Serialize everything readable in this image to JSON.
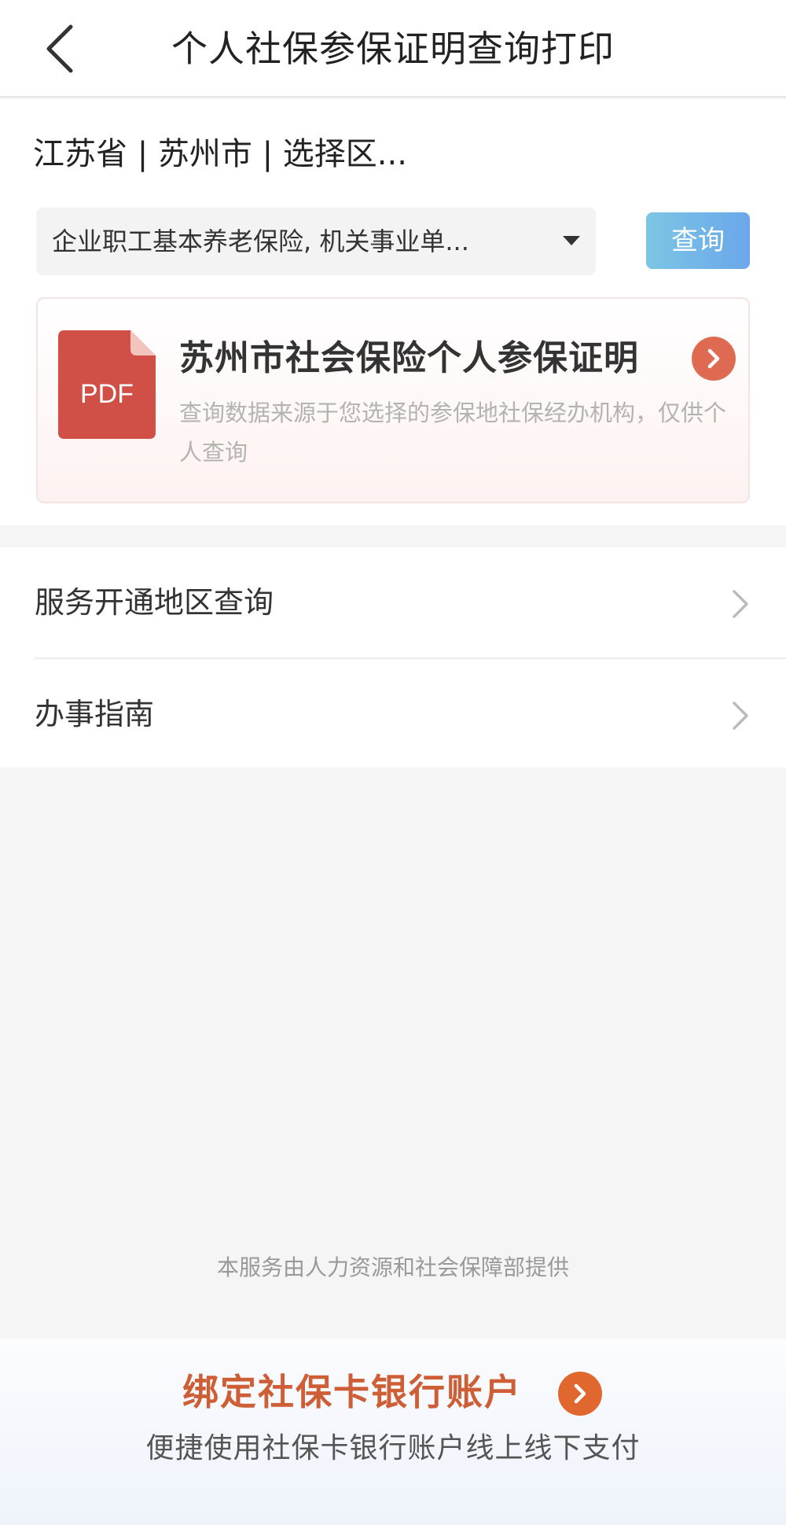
{
  "header": {
    "title": "个人社保参保证明查询打印",
    "back_icon": "chevron-left-icon"
  },
  "region": {
    "text": "江苏省 | 苏州市 | 选择区..."
  },
  "insurance_select": {
    "selected_value": "企业职工基本养老保险, 机关事业单..."
  },
  "query_button": {
    "label": "查询",
    "colors": [
      "#7cc6e4",
      "#6aa7ea"
    ]
  },
  "certificate_card": {
    "icon_label": "PDF",
    "title": "苏州市社会保险个人参保证明",
    "description": "查询数据来源于您选择的参保地社保经办机构，仅供个人查询",
    "accent_color": "#de6a52",
    "pdf_icon_color": "#d04f46"
  },
  "list": {
    "items": [
      {
        "label": "服务开通地区查询"
      },
      {
        "label": "办事指南"
      }
    ]
  },
  "footer_note": "本服务由人力资源和社会保障部提供",
  "bind_banner": {
    "title": "绑定社保卡银行账户",
    "subtitle": "便捷使用社保卡银行账户线上线下支付",
    "title_color": "#cd5e36"
  }
}
